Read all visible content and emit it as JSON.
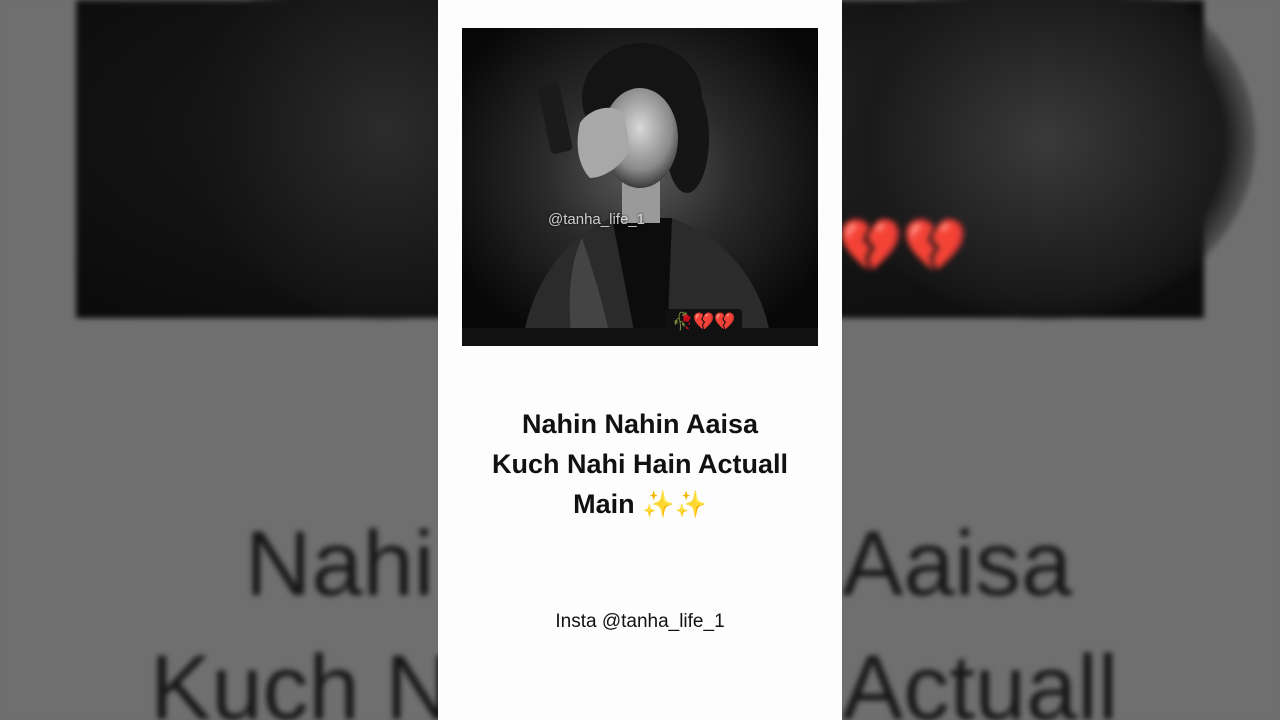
{
  "background": {
    "quote_line_1_left": "Nahi",
    "quote_line_1_right": "Aaisa",
    "quote_line_2_left": "Kuch N",
    "quote_line_2_right": "Actuall",
    "emoji": "💔💔"
  },
  "photo": {
    "watermark": "@tanha_life_1",
    "emoji_badge": "🥀💔💔"
  },
  "quote": {
    "line_1": "Nahin Nahin Aaisa",
    "line_2": "Kuch Nahi Hain Actuall",
    "line_3": "Main",
    "line_3_emoji": "✨✨"
  },
  "insta_handle": "Insta @tanha_life_1",
  "colors": {
    "card": "#fdfdfd",
    "backdrop": "#6e6e6e",
    "photo": "#0d0d0d",
    "text": "#111111"
  }
}
